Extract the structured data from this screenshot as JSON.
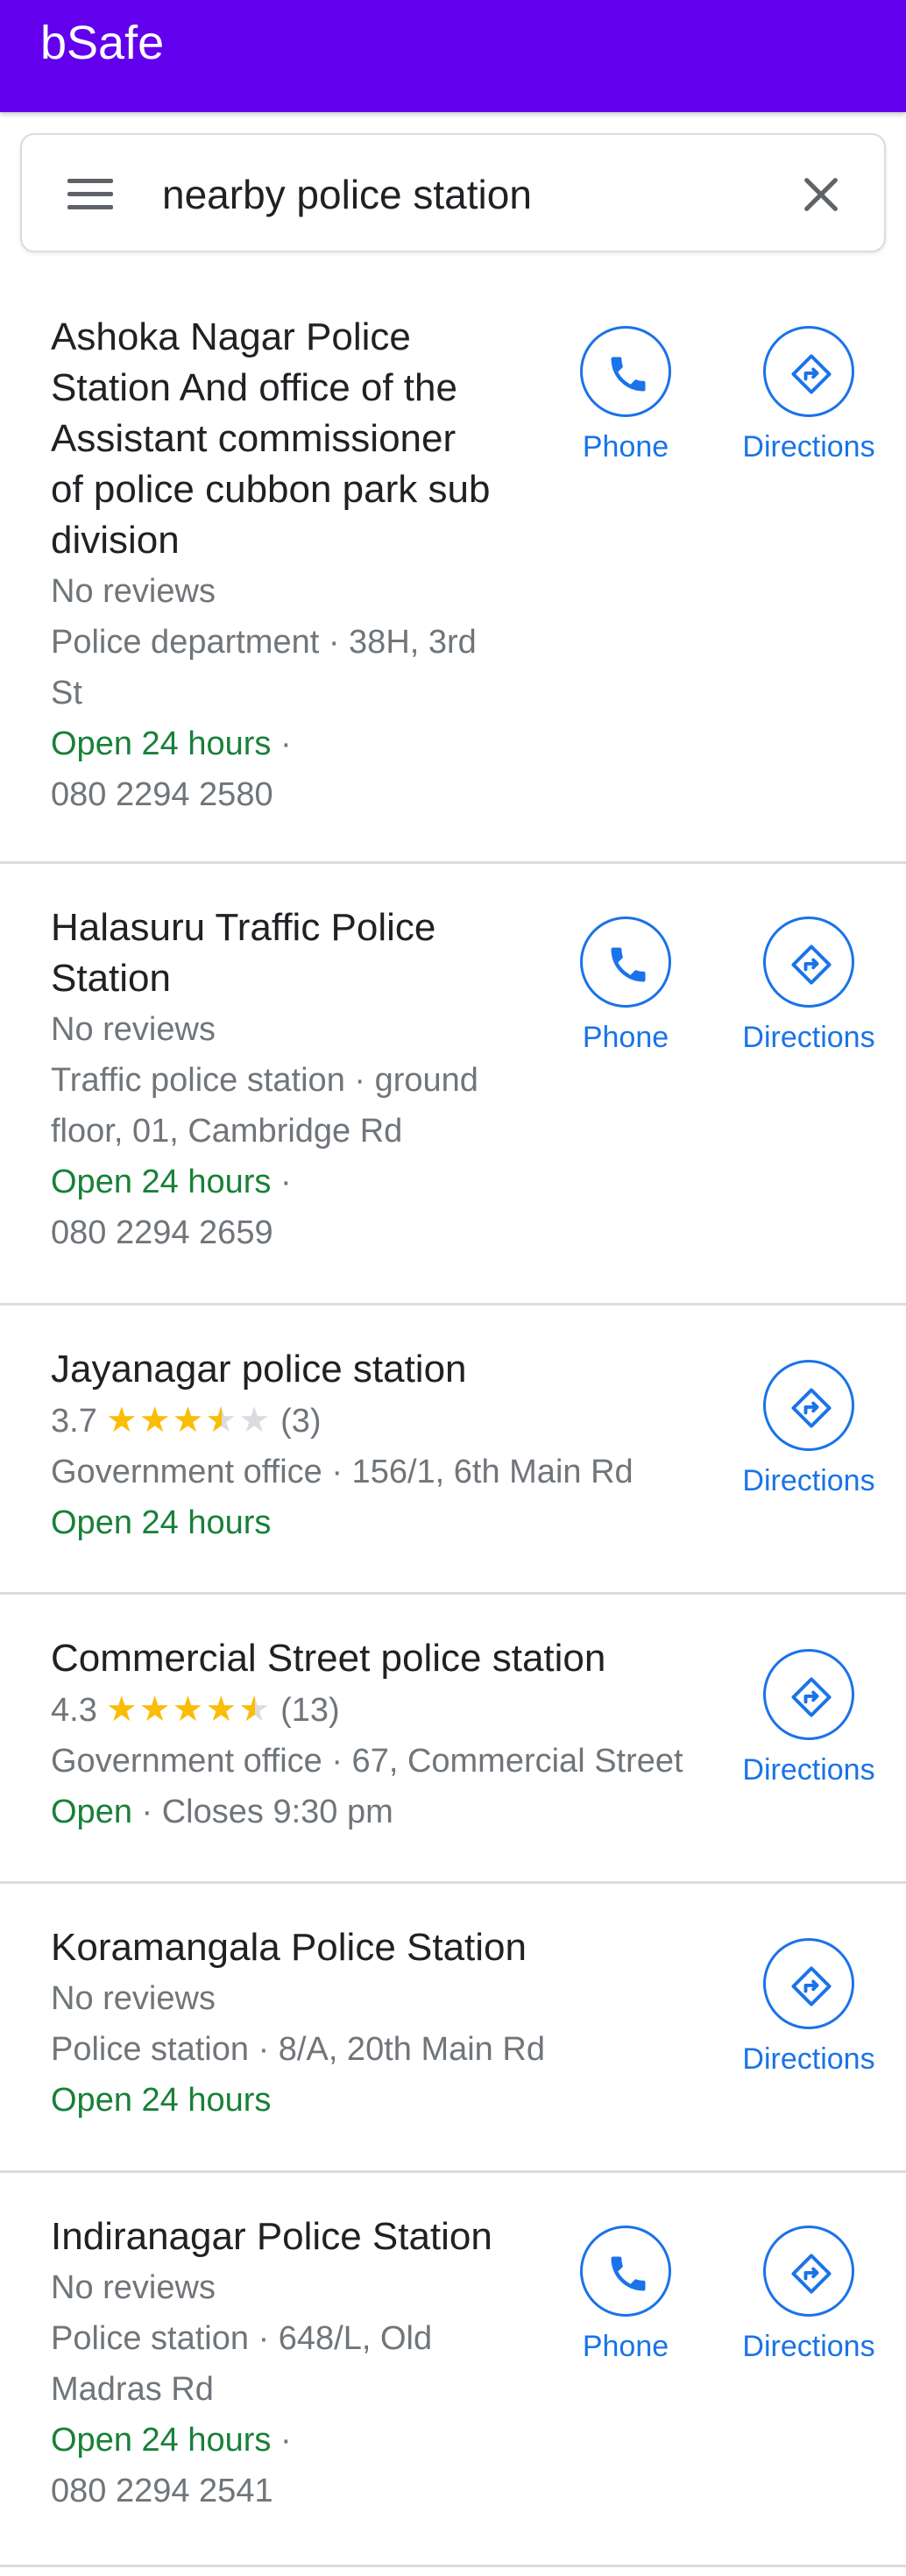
{
  "app": {
    "title": "bSafe"
  },
  "search": {
    "query": "nearby police station"
  },
  "icons": {
    "menu": "menu-icon",
    "close": "close-icon",
    "phone": "phone-icon",
    "directions": "directions-icon"
  },
  "colors": {
    "appbar": "#6200ee",
    "accent": "#1a73e8",
    "open": "#188038",
    "star": "#fbbc04"
  },
  "results": [
    {
      "title_lines": [
        "Ashoka Nagar Police",
        "Station And office of the",
        "Assistant commissioner",
        "of police cubbon park sub",
        "division"
      ],
      "rating_text": "No reviews",
      "detail_lines": [
        "Police department · 38H, 3rd",
        "St"
      ],
      "hours": "Open 24 hours",
      "hours_suffix": " ·",
      "phone_number": "080 2294 2580",
      "phone_label": "Phone",
      "directions_label": "Directions"
    },
    {
      "title_lines": [
        "Halasuru Traffic Police",
        "Station"
      ],
      "rating_text": "No reviews",
      "detail_lines": [
        "Traffic police station · ground",
        "floor, 01, Cambridge Rd"
      ],
      "hours": "Open 24 hours",
      "hours_suffix": " ·",
      "phone_number": "080 2294 2659",
      "phone_label": "Phone",
      "directions_label": "Directions"
    },
    {
      "title_lines": [
        "Jayanagar police station"
      ],
      "rating": 3.7,
      "rating_label": "3.7",
      "review_count": "(3)",
      "detail_lines": [
        "Government office · 156/1, 6th Main Rd"
      ],
      "hours": "Open 24 hours",
      "directions_label": "Directions"
    },
    {
      "title_lines": [
        "Commercial Street police station"
      ],
      "rating": 4.3,
      "rating_label": "4.3",
      "review_count": "(13)",
      "detail_lines": [
        "Government office · 67, Commercial Street"
      ],
      "hours": "Open",
      "hours_suffix": " · Closes 9:30 pm",
      "directions_label": "Directions"
    },
    {
      "title_lines": [
        "Koramangala Police Station"
      ],
      "rating_text": "No reviews",
      "detail_lines": [
        "Police station · 8/A, 20th Main Rd"
      ],
      "hours": "Open 24 hours",
      "directions_label": "Directions"
    },
    {
      "title_lines": [
        "Indiranagar Police Station"
      ],
      "rating_text": "No reviews",
      "detail_lines": [
        "Police station · 648/L, Old",
        "Madras Rd"
      ],
      "hours": "Open 24 hours",
      "hours_suffix": " ·",
      "phone_number": "080 2294 2541",
      "phone_label": "Phone",
      "directions_label": "Directions"
    }
  ]
}
